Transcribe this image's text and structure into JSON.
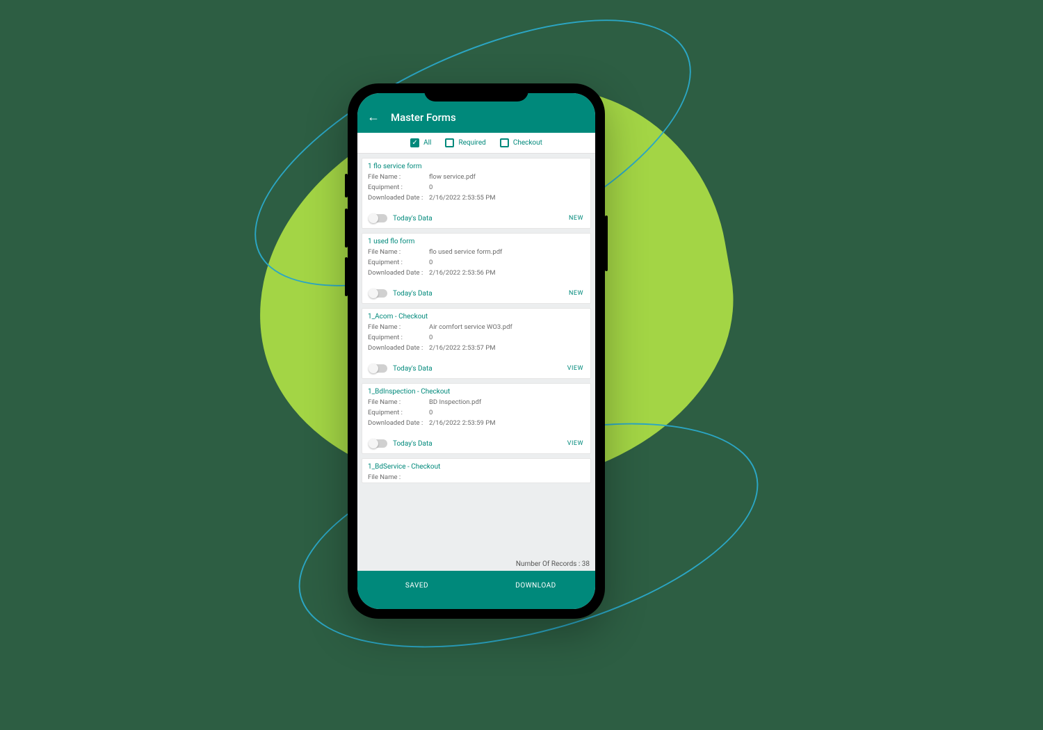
{
  "header": {
    "title": "Master Forms"
  },
  "filters": {
    "all": {
      "label": "All",
      "checked": true
    },
    "required": {
      "label": "Required",
      "checked": false
    },
    "checkout": {
      "label": "Checkout",
      "checked": false
    }
  },
  "field_labels": {
    "file_name": "File Name :",
    "equipment": "Equipment :",
    "downloaded": "Downloaded Date :",
    "todays_data": "Today's Data"
  },
  "forms": [
    {
      "title": "1 flo service form",
      "file_name": "flow service.pdf",
      "equipment": "0",
      "downloaded": "2/16/2022 2:53:55 PM",
      "action": "NEW"
    },
    {
      "title": "1 used flo form",
      "file_name": "flo used service form.pdf",
      "equipment": "0",
      "downloaded": "2/16/2022 2:53:56 PM",
      "action": "NEW"
    },
    {
      "title": "1_Acom - Checkout",
      "file_name": "Air comfort service WO3.pdf",
      "equipment": "0",
      "downloaded": "2/16/2022 2:53:57 PM",
      "action": "VIEW"
    },
    {
      "title": "1_BdInspection - Checkout",
      "file_name": "BD Inspection.pdf",
      "equipment": "0",
      "downloaded": "2/16/2022 2:53:59 PM",
      "action": "VIEW"
    },
    {
      "title": "1_BdService - Checkout",
      "file_name": "",
      "equipment": "",
      "downloaded": "",
      "action": ""
    }
  ],
  "footer": {
    "records_label": "Number Of Records : 38",
    "saved": "SAVED",
    "download": "DOWNLOAD"
  }
}
